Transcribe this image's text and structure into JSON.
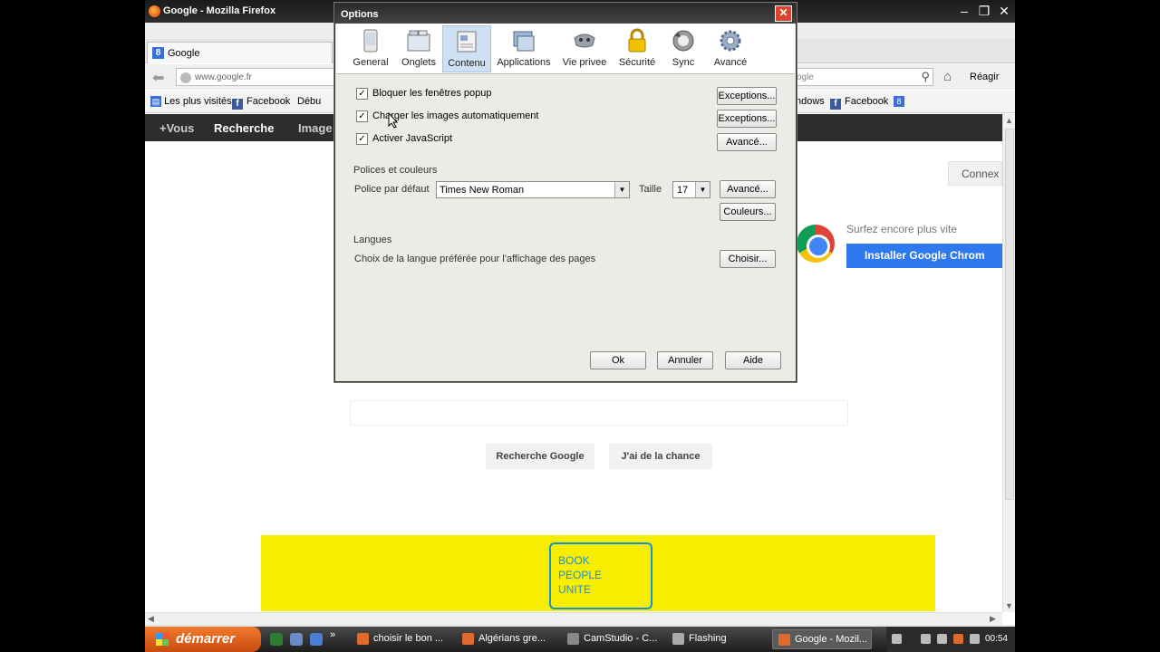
{
  "firefox": {
    "window_title": "Google - Mozilla Firefox",
    "tab_label": "Google",
    "url": "www.google.fr",
    "search_engine_text": "ogle",
    "right_toolbar_label": "Réagir",
    "bookmarks": {
      "most_visited": "Les plus visités",
      "facebook": "Facebook",
      "debut": "Débu",
      "windows": "ndows",
      "facebook_right": "Facebook"
    }
  },
  "google": {
    "topbar_items": [
      "+Vous",
      "Recherche",
      "Image"
    ],
    "connexion_label": "Connex",
    "chrome_promo_text": "Surfez encore plus vite",
    "chrome_install_label": "Installer Google Chrom",
    "search_button": "Recherche Google",
    "lucky_button": "J'ai de la chance",
    "banner_lines": [
      "BOOK",
      "PEOPLE",
      "UNITE"
    ],
    "banner_color": "#f7ee00"
  },
  "options": {
    "title": "Options",
    "tabs": [
      {
        "label": "General",
        "icon": "general-icon"
      },
      {
        "label": "Onglets",
        "icon": "tabs-icon"
      },
      {
        "label": "Contenu",
        "icon": "content-icon",
        "selected": true
      },
      {
        "label": "Applications",
        "icon": "applications-icon"
      },
      {
        "label": "Vie privee",
        "icon": "privacy-icon"
      },
      {
        "label": "Sécurité",
        "icon": "lock-icon"
      },
      {
        "label": "Sync",
        "icon": "sync-icon"
      },
      {
        "label": "Avancé",
        "icon": "gear-icon"
      }
    ],
    "checkboxes": [
      {
        "label": "Bloquer les fenêtres popup",
        "checked": true,
        "button": "Exceptions..."
      },
      {
        "label": "Charger les images automatiquement",
        "checked": true,
        "button": "Exceptions..."
      },
      {
        "label": "Activer JavaScript",
        "checked": true,
        "button": "Avancé..."
      }
    ],
    "fonts_section": "Polices et couleurs",
    "default_font_label": "Police par défaut",
    "default_font_value": "Times New Roman",
    "size_label": "Taille",
    "size_value": "17",
    "fonts_advanced_button": "Avancé...",
    "colors_button": "Couleurs...",
    "languages_section": "Langues",
    "languages_text": "Choix de la langue préférée pour l'affichage des pages",
    "choose_button": "Choisir...",
    "ok_button": "Ok",
    "cancel_button": "Annuler",
    "help_button": "Aide",
    "close_symbol": "✕"
  },
  "taskbar": {
    "start_label": "démarrer",
    "tasks": [
      "choisir le bon ...",
      "Algérians gre...",
      "CamStudio - C...",
      "Flashing",
      "Google - Mozil..."
    ],
    "clock": "00:54"
  }
}
